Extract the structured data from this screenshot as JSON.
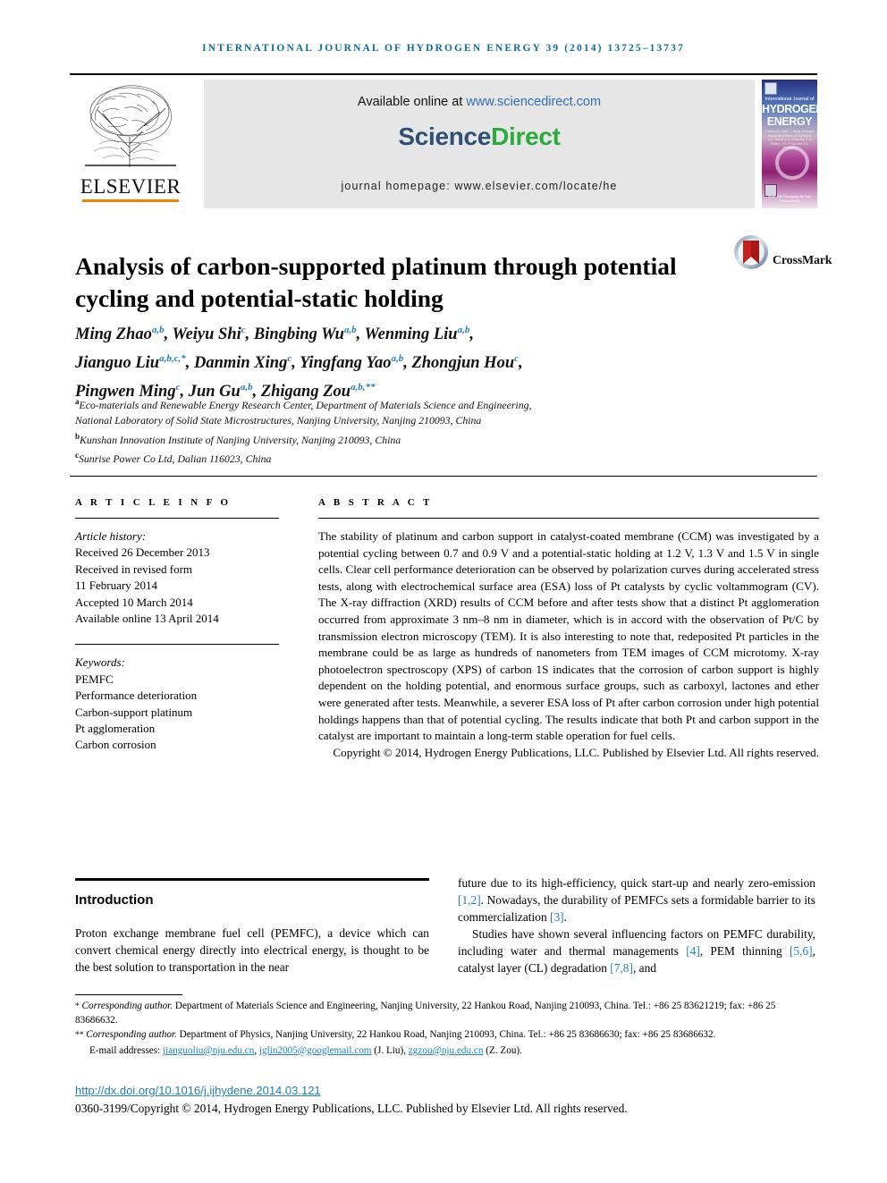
{
  "running_head": "International Journal of Hydrogen Energy 39 (2014) 13725–13737",
  "banner": {
    "publisher": "ELSEVIER",
    "available_text": "Available online at",
    "available_link": "www.sciencedirect.com",
    "brand_science": "Science",
    "brand_direct": "Direct",
    "homepage": "journal homepage: www.elsevier.com/locate/he",
    "cover": {
      "line1": "International Journal of",
      "line2": "HYDROGEN",
      "line3": "ENERGY",
      "editors": "Editors-in-Chief:  T. Nejat Veziroglu\nAssociate Editors: A. Steinfeld, S.A. Sherif,\nA.C. Chandra, D.M. Rufino,\nJ.N. Frost and D.A. Scarpello",
      "footer": "IAHE The Foundation for Fuel\nScienceDirect"
    },
    "colors": {
      "sciencedirect_green": "#2bab3c",
      "elsevier_orange": "#ef8200",
      "link_blue": "#2f6fb5"
    }
  },
  "title": "Analysis of carbon-supported platinum through potential cycling and potential-static holding",
  "crossmark_label": "CrossMark",
  "authors_html": "Ming Zhao<sup>a,b</sup>, Weiyu Shi<sup>c</sup>, Bingbing Wu<sup>a,b</sup>, Wenming Liu<sup>a,b</sup>,<br>Jianguo Liu<sup>a,b,c,*</sup>, Danmin Xing<sup>c</sup>, Yingfang Yao<sup>a,b</sup>, Zhongjun Hou<sup>c</sup>,<br>Pingwen Ming<sup>c</sup>, Jun Gu<sup>a,b</sup>, Zhigang Zou<sup>a,b,**</sup>",
  "affiliations_html": "<sup>a</sup>Eco-materials and Renewable Energy Research Center, Department of Materials Science and Engineering,<br>National Laboratory of Solid State Microstructures, Nanjing University, Nanjing 210093, China<br><sup>b</sup>Kunshan Innovation Institute of Nanjing University, Nanjing 210093, China<br><sup>c</sup>Sunrise Power Co Ltd, Dalian 116023, China",
  "article_info": {
    "heading": "A R T I C L E  I N F O",
    "history_label": "Article history:",
    "history": [
      "Received 26 December 2013",
      "Received in revised form",
      "11 February 2014",
      "Accepted 10 March 2014",
      "Available online 13 April 2014"
    ],
    "keywords_label": "Keywords:",
    "keywords": [
      "PEMFC",
      "Performance deterioration",
      "Carbon-support platinum",
      "Pt agglomeration",
      "Carbon corrosion"
    ]
  },
  "abstract": {
    "heading": "A B S T R A C T",
    "text": "The stability of platinum and carbon support in catalyst-coated membrane (CCM) was investigated by a potential cycling between 0.7 and 0.9 V and a potential-static holding at 1.2 V, 1.3 V and 1.5 V in single cells. Clear cell performance deterioration can be observed by polarization curves during accelerated stress tests, along with electrochemical surface area (ESA) loss of Pt catalysts by cyclic voltammogram (CV). The X-ray diffraction (XRD) results of CCM before and after tests show that a distinct Pt agglomeration occurred from approximate 3 nm–8 nm in diameter, which is in accord with the observation of Pt/C by transmission electron microscopy (TEM). It is also interesting to note that, redeposited Pt particles in the membrane could be as large as hundreds of nanometers from TEM images of CCM microtomy. X-ray photoelectron spectroscopy (XPS) of carbon 1S indicates that the corrosion of carbon support is highly dependent on the holding potential, and enormous surface groups, such as carboxyl, lactones and ether were generated after tests. Meanwhile, a severer ESA loss of Pt after carbon corrosion under high potential holdings happens than that of potential cycling. The results indicate that both Pt and carbon support in the catalyst are important to maintain a long-term stable operation for fuel cells.",
    "copyright": "Copyright © 2014, Hydrogen Energy Publications, LLC. Published by Elsevier Ltd. All rights reserved."
  },
  "body": {
    "intro_heading": "Introduction",
    "para1_left": "Proton exchange membrane fuel cell (PEMFC), a device which can convert chemical energy directly into electrical energy, is thought to be the best solution to transportation in the near",
    "para1_right_html": "future due to its high-efficiency, quick start-up and nearly zero-emission <span class=\"ref\">[1,2]</span>. Nowadays, the durability of PEMFCs sets a formidable barrier to its commercialization <span class=\"ref\">[3]</span>.",
    "para2_right_html": "Studies have shown several influencing factors on PEMFC durability, including water and thermal managements <span class=\"ref\">[4]</span>, PEM thinning <span class=\"ref\">[5,6]</span>, catalyst layer (CL) degradation <span class=\"ref\">[7,8]</span>, and"
  },
  "footnotes": {
    "fn1_html": "<span class=\"star\">*</span> <em>Corresponding author.</em> Department of Materials Science and Engineering, Nanjing University, 22 Hankou Road, Nanjing 210093, China. Tel.: +86 25 83621219; fax: +86 25 83686632.",
    "fn2_html": "<span class=\"star\">**</span> <em>Corresponding author.</em> Department of Physics, Nanjing University, 22 Hankou Road, Nanjing 210093, China. Tel.: +86 25 83686630; fax: +86 25 83686632.",
    "email_label": "E-mail addresses:",
    "email1": "jianguoliu@nju.edu.cn",
    "email2": "jglin2005@googlemail.com",
    "email_note1": "(J. Liu),",
    "email3": "zgzou@nju.edu.cn",
    "email_note2": "(Z. Zou).",
    "doi": "http://dx.doi.org/10.1016/j.ijhydene.2014.03.121",
    "issn_line": "0360-3199/Copyright © 2014, Hydrogen Energy Publications, LLC. Published by Elsevier Ltd. All rights reserved."
  }
}
